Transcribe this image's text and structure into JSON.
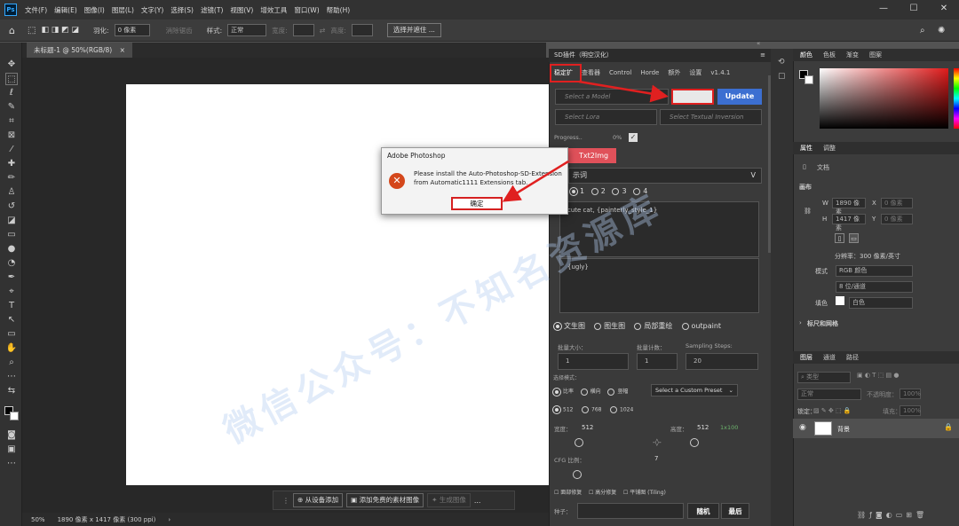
{
  "menu": [
    "文件(F)",
    "编辑(E)",
    "图像(I)",
    "图层(L)",
    "文字(Y)",
    "选择(S)",
    "滤镜(T)",
    "视图(V)",
    "增效工具",
    "窗口(W)",
    "帮助(H)"
  ],
  "app_logo": "Ps",
  "options": {
    "feather_label": "羽化:",
    "feather_value": "0 像素",
    "smooth_label": "消除锯齿",
    "style_label": "样式:",
    "style_value": "正常",
    "width_label": "宽度:",
    "height_label": "高度:",
    "select_mask": "选择并遮住 ..."
  },
  "doc_tab": "未标题-1 @ 50%(RGB/8)",
  "status": {
    "zoom": "50%",
    "info": "1890 像素 x 1417 像素 (300 ppi)"
  },
  "ctx": {
    "add_device": "从设备添加",
    "add_free": "添加免费的素材图像",
    "generate": "生成图像",
    "more": "..."
  },
  "sd": {
    "title": "SD插件（明空汉化）",
    "tabs": [
      "稳定扩",
      "查看器",
      "Control",
      "Horde",
      "额外",
      "设置",
      "v1.4.1"
    ],
    "model_placeholder": "Select a Model",
    "update": "Update",
    "lora_placeholder": "Select Lora",
    "ti_placeholder": "Select Textual Inversion",
    "progress_label": "Progress..",
    "progress_value": "0%",
    "txt2img": "Txt2Img",
    "prompt_header": "示词",
    "prompt_header_v": "V",
    "prompt_radios": [
      "1",
      "2",
      "3",
      "4"
    ],
    "prompt": "cute cat, {painterly_style_1}",
    "negative": "{ugly}",
    "modes": [
      "文生图",
      "图生图",
      "局部重绘",
      "outpaint"
    ],
    "batch_size_label": "批量大小：",
    "batch_size": "1",
    "batch_count_label": "批量计数：",
    "batch_count": "1",
    "steps_label": "Sampling Steps:",
    "steps": "20",
    "preset_label": "选择模式：",
    "ratio_opts": [
      "比率",
      "横向",
      "竖幅"
    ],
    "preset_select": "Select a Custom Preset",
    "sizes": [
      "512",
      "768",
      "1024"
    ],
    "width_label": "宽度：",
    "width_val": "512",
    "height_label": "高度：",
    "height_val": "512",
    "hires_val": "1x100",
    "cfg_label": "CFG 比例：",
    "cfg_val": "7",
    "checks": [
      "面部修复",
      "高分修复",
      "平铺图 (Tiling)"
    ],
    "seed_label": "种子：",
    "random": "随机",
    "last": "最后"
  },
  "right": {
    "tabs1": [
      "颜色",
      "色板",
      "渐变",
      "图案"
    ],
    "tabs2": [
      "属性",
      "调整"
    ],
    "doc": "文档",
    "canvas_header": "画布",
    "w_label": "W",
    "w_val": "1890 像素",
    "x_label": "X",
    "x_val": "0 像素",
    "h_label": "H",
    "h_val": "1417 像素",
    "y_label": "Y",
    "y_val": "0 像素",
    "resolution": "分辨率：300 像素/英寸",
    "mode_label": "模式",
    "mode_val": "RGB 颜色",
    "bits_val": "8 位/通道",
    "fill_label": "填色",
    "fill_val": "白色",
    "rulers": "标尺和网格",
    "tabs3": [
      "图层",
      "通道",
      "路径"
    ],
    "layer_search": "类型",
    "blend": "正常",
    "opacity_label": "不透明度：",
    "opacity_val": "100%",
    "lock_label": "锁定：",
    "fill2_label": "填充：",
    "fill2_val": "100%",
    "layer_name": "背景"
  },
  "dialog": {
    "title": "Adobe Photoshop",
    "message": "Please install the Auto-Photoshop-SD-Extension from Automatic1111 Extensions tab.",
    "ok": "确定"
  },
  "watermark": "微信公众号：不知名资源库",
  "colors": {
    "accent_red": "#e02020",
    "update_blue": "#3c6fd1",
    "txt2img_red": "#e0515a"
  }
}
